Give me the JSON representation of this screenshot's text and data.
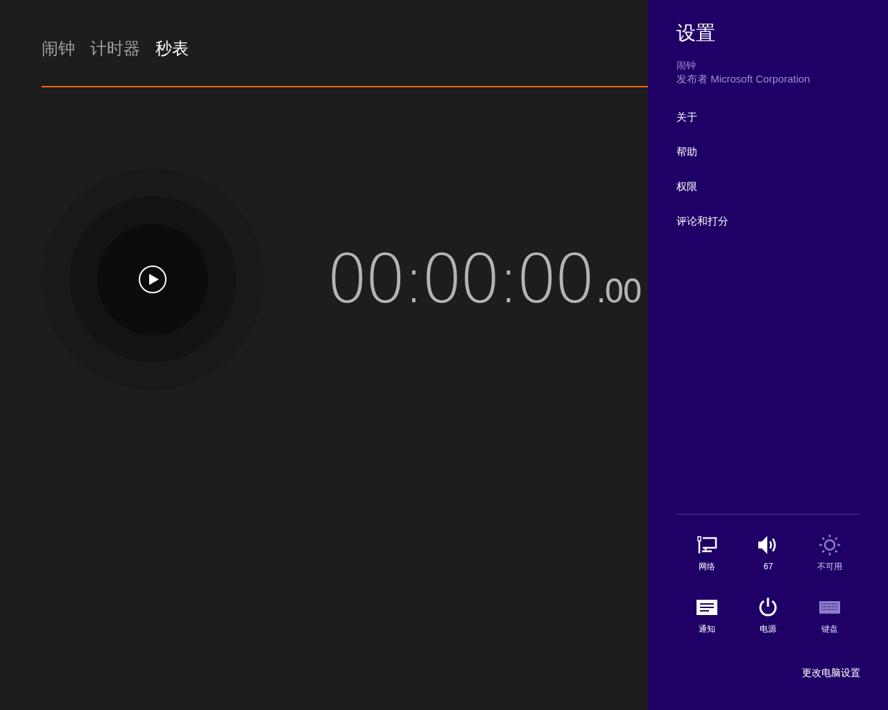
{
  "tabs": [
    {
      "label": "闹钟",
      "selected": false
    },
    {
      "label": "计时器",
      "selected": false
    },
    {
      "label": "秒表",
      "selected": true
    }
  ],
  "stopwatch": {
    "main": "00:00:00",
    "fraction": ".00"
  },
  "settings_pane": {
    "title": "设置",
    "app_name": "闹钟",
    "publisher": "发布者 Microsoft Corporation",
    "links": [
      "关于",
      "帮助",
      "权限",
      "评论和打分"
    ],
    "tiles": [
      {
        "kind": "network",
        "label": "网络",
        "disabled": false
      },
      {
        "kind": "volume",
        "label": "67",
        "disabled": false
      },
      {
        "kind": "brightness",
        "label": "不可用",
        "disabled": true
      },
      {
        "kind": "notifications",
        "label": "通知",
        "disabled": false
      },
      {
        "kind": "power",
        "label": "电源",
        "disabled": false
      },
      {
        "kind": "keyboard",
        "label": "键盘",
        "disabled": true
      }
    ],
    "footer_link": "更改电脑设置"
  }
}
